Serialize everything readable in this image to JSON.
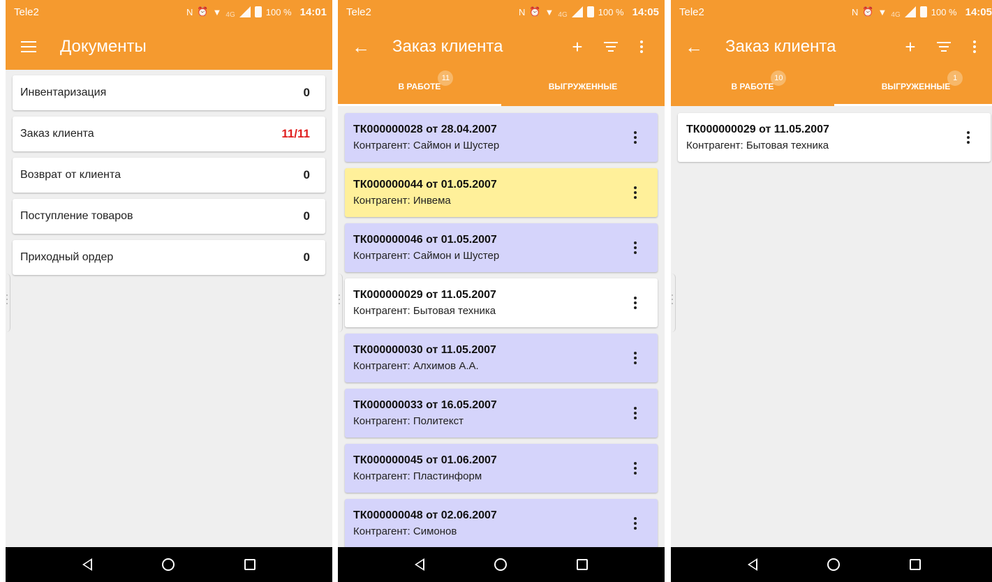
{
  "colors": {
    "primary": "#f59a2f",
    "highlight_red": "#e02020",
    "card_purple": "#d5d4fb",
    "card_yellow": "#fff09a"
  },
  "screen1": {
    "status": {
      "carrier": "Tele2",
      "battery": "100 %",
      "time": "14:01",
      "network": "4G"
    },
    "title": "Документы",
    "menu_icon": "hamburger-icon",
    "documents": [
      {
        "name": "Инвентаризация",
        "count": "0",
        "highlight": false
      },
      {
        "name": "Заказ клиента",
        "count": "11/11",
        "highlight": true
      },
      {
        "name": "Возврат от клиента",
        "count": "0",
        "highlight": false
      },
      {
        "name": "Поступление товаров",
        "count": "0",
        "highlight": false
      },
      {
        "name": "Приходный ордер",
        "count": "0",
        "highlight": false
      }
    ]
  },
  "screen2": {
    "status": {
      "carrier": "Tele2",
      "battery": "100 %",
      "time": "14:05",
      "network": "4G"
    },
    "title": "Заказ клиента",
    "tabs": [
      {
        "label": "В РАБОТЕ",
        "badge": "11",
        "active": true
      },
      {
        "label": "ВЫГРУЖЕННЫЕ",
        "badge": "",
        "active": false
      }
    ],
    "orders": [
      {
        "number": "ТК000000028 от 28.04.2007",
        "counterparty": "Контрагент: Саймон и Шустер",
        "color": "purple"
      },
      {
        "number": "ТК000000044 от 01.05.2007",
        "counterparty": "Контрагент: Инвема",
        "color": "yellow"
      },
      {
        "number": "ТК000000046 от 01.05.2007",
        "counterparty": "Контрагент: Саймон и Шустер",
        "color": "purple"
      },
      {
        "number": "ТК000000029 от 11.05.2007",
        "counterparty": "Контрагент: Бытовая техника",
        "color": "white"
      },
      {
        "number": "ТК000000030 от 11.05.2007",
        "counterparty": "Контрагент: Алхимов А.А.",
        "color": "purple"
      },
      {
        "number": "ТК000000033 от 16.05.2007",
        "counterparty": "Контрагент: Политекст",
        "color": "purple"
      },
      {
        "number": "ТК000000045 от 01.06.2007",
        "counterparty": "Контрагент: Пластинформ",
        "color": "purple"
      },
      {
        "number": "ТК000000048 от 02.06.2007",
        "counterparty": "Контрагент: Симонов",
        "color": "purple"
      }
    ]
  },
  "screen3": {
    "status": {
      "carrier": "Tele2",
      "battery": "100 %",
      "time": "14:05",
      "network": "4G"
    },
    "title": "Заказ клиента",
    "tabs": [
      {
        "label": "В РАБОТЕ",
        "badge": "10",
        "active": false
      },
      {
        "label": "ВЫГРУЖЕННЫЕ",
        "badge": "1",
        "active": true
      }
    ],
    "orders": [
      {
        "number": "ТК000000029 от 11.05.2007",
        "counterparty": "Контрагент: Бытовая техника",
        "color": "white"
      }
    ]
  }
}
